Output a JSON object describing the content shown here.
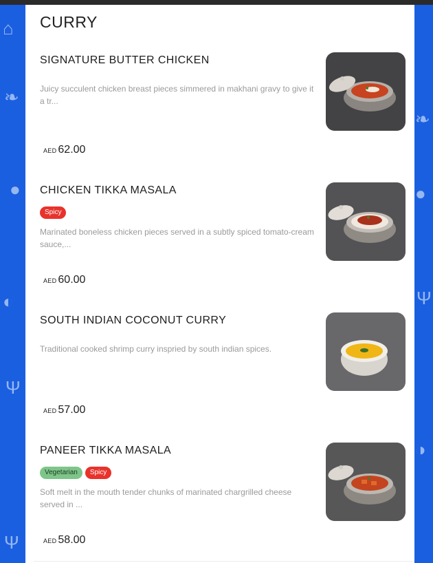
{
  "section": {
    "title": "CURRY"
  },
  "items": [
    {
      "name": "SIGNATURE BUTTER CHICKEN",
      "badges": [],
      "description": "Juicy succulent chicken breast pieces simmered in makhani gravy to give it a tr...",
      "currency": "AED",
      "price": "62.00",
      "image": "butter-chicken-dish-photo"
    },
    {
      "name": "CHICKEN TIKKA MASALA",
      "badges": [
        "Spicy"
      ],
      "description": "Marinated boneless chicken pieces served in a subtly spiced tomato-cream sauce,...",
      "currency": "AED",
      "price": "60.00",
      "image": "tikka-masala-dish-photo"
    },
    {
      "name": "SOUTH INDIAN COCONUT CURRY",
      "badges": [],
      "description": "Traditional cooked shrimp curry inspried by south indian spices.",
      "currency": "AED",
      "price": "57.00",
      "image": "coconut-curry-dish-photo"
    },
    {
      "name": "PANEER TIKKA MASALA",
      "badges": [
        "Vegetarian",
        "Spicy"
      ],
      "description": "Soft melt in the mouth tender chunks of marinated chargrilled cheese served in ...",
      "currency": "AED",
      "price": "58.00",
      "image": "paneer-dish-photo"
    }
  ],
  "colors": {
    "background": "#1a5fe0",
    "spicy_badge": "#e8322b",
    "vegetarian_badge": "#7ec58a"
  }
}
